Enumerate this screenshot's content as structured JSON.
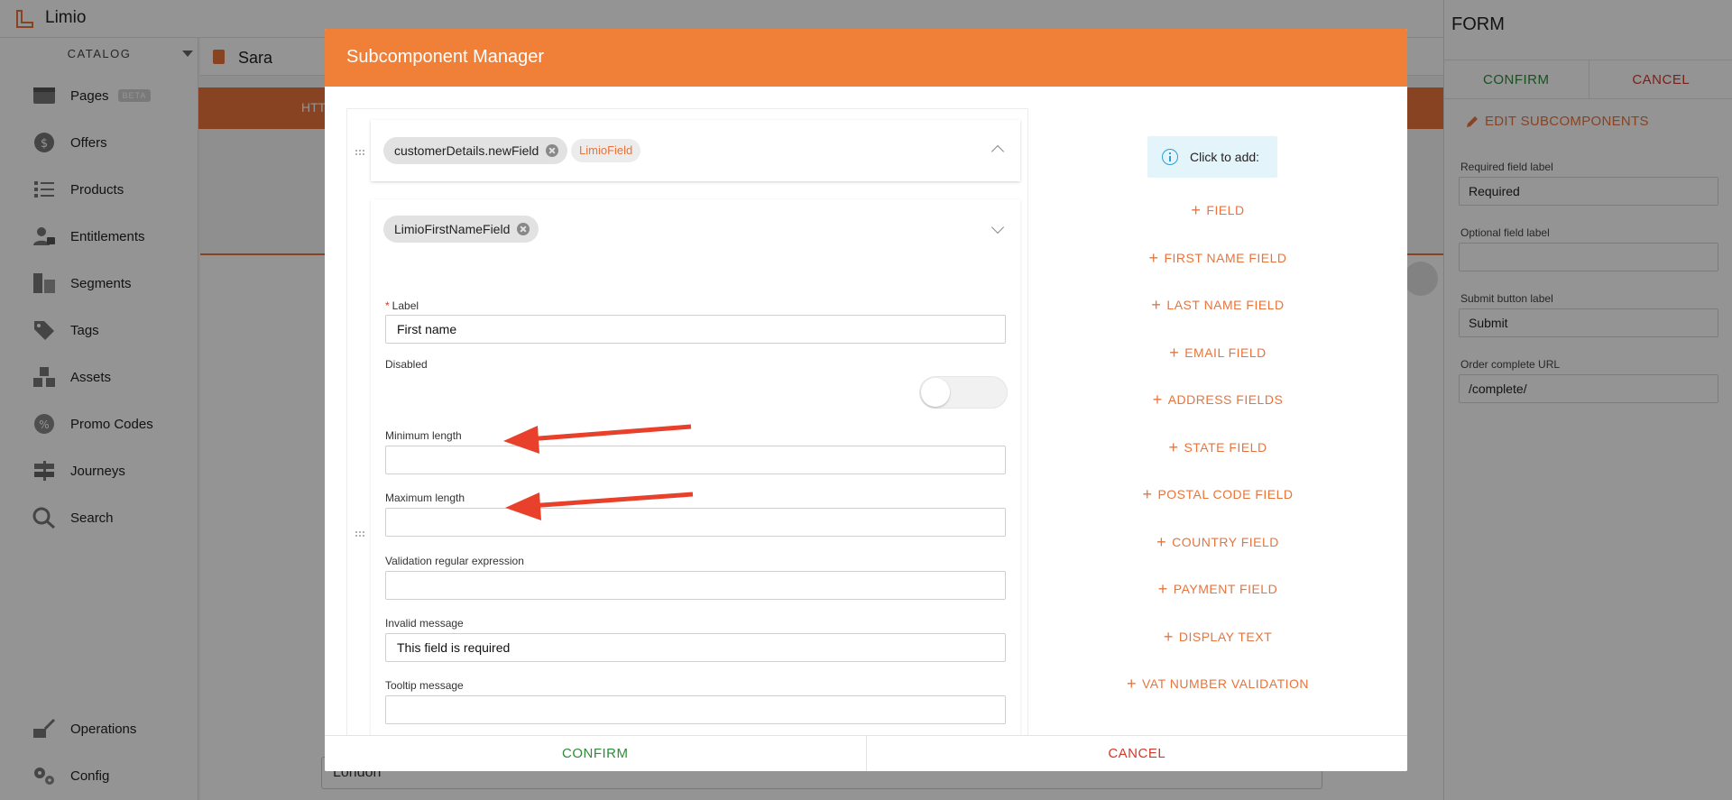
{
  "app": {
    "name": "Limio"
  },
  "sidebar": {
    "section": "CATALOG",
    "items": [
      {
        "label": "Pages",
        "badge": "BETA",
        "icon": "pages-icon"
      },
      {
        "label": "Offers",
        "icon": "offers-icon"
      },
      {
        "label": "Products",
        "icon": "products-icon"
      },
      {
        "label": "Entitlements",
        "icon": "entitlements-icon"
      },
      {
        "label": "Segments",
        "icon": "segments-icon"
      },
      {
        "label": "Tags",
        "icon": "tags-icon"
      },
      {
        "label": "Assets",
        "icon": "assets-icon"
      },
      {
        "label": "Promo Codes",
        "icon": "promo-codes-icon"
      },
      {
        "label": "Journeys",
        "icon": "journeys-icon"
      },
      {
        "label": "Search",
        "icon": "search-icon"
      }
    ],
    "bottom": [
      {
        "label": "Operations",
        "icon": "operations-icon"
      },
      {
        "label": "Config",
        "icon": "config-icon"
      }
    ]
  },
  "breadcrumb": {
    "title": "Sara"
  },
  "background": {
    "band_text": "HTT",
    "address_value": "London"
  },
  "form_panel": {
    "title": "FORM",
    "confirm": "CONFIRM",
    "cancel": "CANCEL",
    "edit_subcomponents": "EDIT SUBCOMPONENTS",
    "fields": [
      {
        "label": "Required field label",
        "value": "Required"
      },
      {
        "label": "Optional field label",
        "value": ""
      },
      {
        "label": "Submit button label",
        "value": "Submit"
      },
      {
        "label": "Order complete URL",
        "value": "/complete/"
      }
    ]
  },
  "modal": {
    "title": "Subcomponent Manager",
    "parent_chip": "customerDetails.newField",
    "parent_tag": "LimioField",
    "child_chip": "LimioFirstNameField",
    "fields": {
      "label": {
        "label": "Label",
        "value": "First name",
        "required": "*"
      },
      "disabled": {
        "label": "Disabled",
        "value": false
      },
      "min_length": {
        "label": "Minimum length",
        "value": ""
      },
      "max_length": {
        "label": "Maximum length",
        "value": ""
      },
      "validation_regex": {
        "label": "Validation regular expression",
        "value": ""
      },
      "invalid_message": {
        "label": "Invalid message",
        "value": "This field is required"
      },
      "tooltip_message": {
        "label": "Tooltip message",
        "value": ""
      }
    },
    "add_panel": {
      "hint": "Click to add:",
      "buttons": [
        "FIELD",
        "FIRST NAME FIELD",
        "LAST NAME FIELD",
        "EMAIL FIELD",
        "ADDRESS FIELDS",
        "STATE FIELD",
        "POSTAL CODE FIELD",
        "COUNTRY FIELD",
        "PAYMENT FIELD",
        "DISPLAY TEXT",
        "VAT NUMBER VALIDATION"
      ]
    },
    "confirm": "CONFIRM",
    "cancel": "CANCEL"
  },
  "colors": {
    "accent": "#f07f38",
    "confirm": "#2e8b3a",
    "cancel": "#d0392b",
    "annotation_arrow": "#e8402b"
  }
}
